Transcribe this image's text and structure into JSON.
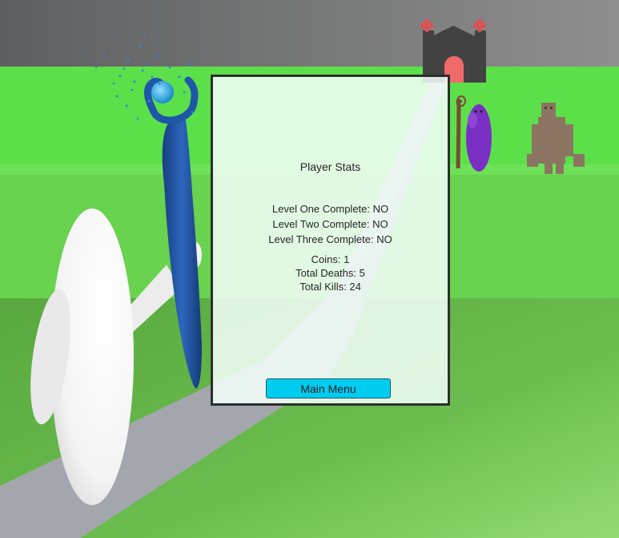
{
  "colors": {
    "sky": "#6a6a6a",
    "far_grass": "#5ce04a",
    "near_grass": "#6ab94e",
    "path": "#a3a7ad",
    "player_body": "#ffffff",
    "staff": "#1f56a8",
    "castle": "#424242",
    "castle_flag": "#d25656",
    "castle_door": "#f06a6a",
    "wizard": "#7a2fc4",
    "golem": "#8b7562",
    "panel_bg": "#f5fffa",
    "button_bg": "#00ccf0"
  },
  "icons": [
    "castle-icon",
    "wizard-enemy",
    "golem-enemy",
    "magic-staff",
    "player-character"
  ],
  "stats_panel": {
    "title": "Player Stats",
    "levels": [
      {
        "label": "Level One Complete:",
        "value": "NO"
      },
      {
        "label": "Level Two Complete:",
        "value": "NO"
      },
      {
        "label": "Level Three Complete:",
        "value": "NO"
      }
    ],
    "totals": [
      {
        "label": "Coins:",
        "value": "1"
      },
      {
        "label": "Total Deaths:",
        "value": "5"
      },
      {
        "label": "Total Kills:",
        "value": "24"
      }
    ],
    "main_menu_label": "Main Menu"
  }
}
